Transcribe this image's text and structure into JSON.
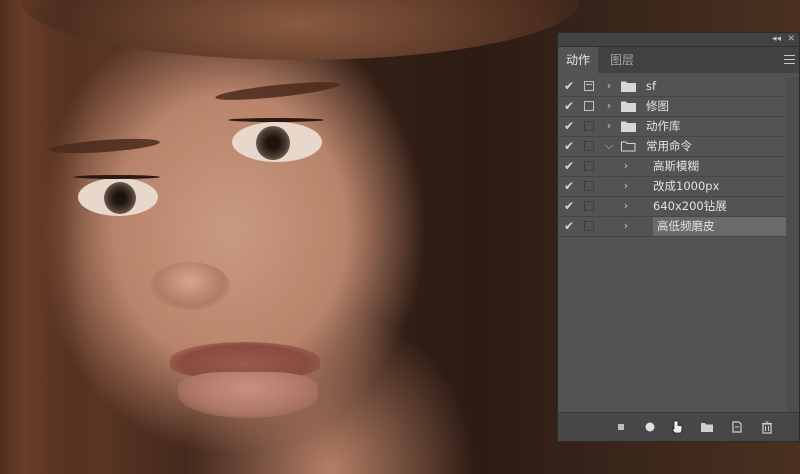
{
  "tabs": [
    {
      "label": "动作",
      "active": true
    },
    {
      "label": "图层",
      "active": false
    }
  ],
  "titlebar": {
    "collapse_glyph": "◂◂",
    "close_glyph": "✕"
  },
  "actions": [
    {
      "label": "sf",
      "type": "set",
      "checked": true,
      "dialog": "mixed",
      "expanded": false,
      "indent": 0
    },
    {
      "label": "修图",
      "type": "set",
      "checked": true,
      "dialog": "on",
      "expanded": false,
      "indent": 0
    },
    {
      "label": "动作库",
      "type": "set",
      "checked": true,
      "dialog": "off",
      "expanded": false,
      "indent": 0
    },
    {
      "label": "常用命令",
      "type": "set",
      "checked": true,
      "dialog": "off",
      "expanded": true,
      "indent": 0
    },
    {
      "label": "高斯模糊",
      "type": "action",
      "checked": true,
      "dialog": "off",
      "expanded": false,
      "indent": 1
    },
    {
      "label": "改成1000px",
      "type": "action",
      "checked": true,
      "dialog": "off",
      "expanded": false,
      "indent": 1
    },
    {
      "label": "640x200钻展",
      "type": "action",
      "checked": true,
      "dialog": "off",
      "expanded": false,
      "indent": 1
    },
    {
      "label": "高低频磨皮",
      "type": "action",
      "checked": true,
      "dialog": "off",
      "expanded": false,
      "indent": 1,
      "selected": true
    }
  ],
  "footer_buttons": [
    {
      "name": "stop-button",
      "icon": "stop-icon"
    },
    {
      "name": "record-button",
      "icon": "record-icon"
    },
    {
      "name": "play-button",
      "icon": "play-icon"
    },
    {
      "name": "new-set-button",
      "icon": "folder-icon"
    },
    {
      "name": "new-action-button",
      "icon": "new-page-icon"
    },
    {
      "name": "delete-button",
      "icon": "trash-icon"
    }
  ],
  "colors": {
    "panel_bg": "#535353",
    "tab_bar_bg": "#424242",
    "selected_row_bg": "#6a6a6a",
    "text": "#e2e2e2"
  }
}
